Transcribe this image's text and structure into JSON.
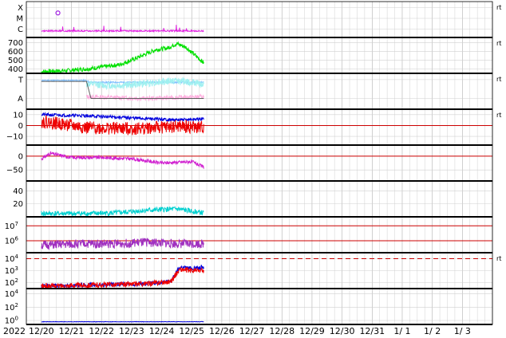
{
  "chart_data": {
    "type": "line",
    "year_label": "2022",
    "x_ticks": [
      "12/20",
      "12/21",
      "12/22",
      "12/23",
      "12/24",
      "12/25",
      "12/26",
      "12/27",
      "12/28",
      "12/29",
      "12/30",
      "12/31",
      "1/ 1",
      "1/ 2",
      "1/ 3"
    ],
    "data_end_index": 5.4,
    "panels": [
      {
        "id": "xray-class",
        "y_range": [
          0,
          3
        ],
        "y_tick_labels": [
          {
            "v": 2.5,
            "t": "X"
          },
          {
            "v": 1.6,
            "t": "M"
          },
          {
            "v": 0.7,
            "t": "C"
          }
        ],
        "ref_lines": [],
        "side_label": "rt",
        "series": [
          {
            "color": "#e020e0",
            "base": 0.55,
            "amp": 0.12,
            "spike": 0.5,
            "seed": 3
          }
        ],
        "marker": {
          "x": 0.55,
          "y": 2.05,
          "color": "#a020e0"
        }
      },
      {
        "id": "solar-wind-speed",
        "y_range": [
          350,
          760
        ],
        "y_tick_labels": [
          {
            "v": 700,
            "t": "700"
          },
          {
            "v": 600,
            "t": "600"
          },
          {
            "v": 500,
            "t": "500"
          },
          {
            "v": 400,
            "t": "400"
          }
        ],
        "ref_lines": [],
        "side_label": "rt",
        "series": [
          {
            "color": "#00e000",
            "profile": [
              [
                0,
                370
              ],
              [
                0.8,
                380
              ],
              [
                1.5,
                400
              ],
              [
                2.2,
                430
              ],
              [
                2.6,
                450
              ],
              [
                3.0,
                500
              ],
              [
                3.4,
                560
              ],
              [
                3.8,
                620
              ],
              [
                4.2,
                640
              ],
              [
                4.5,
                690
              ],
              [
                4.8,
                650
              ],
              [
                5.1,
                560
              ],
              [
                5.4,
                470
              ]
            ],
            "noise": 25,
            "seed": 7
          }
        ]
      },
      {
        "id": "temperature-alpha",
        "y_range": [
          0,
          4
        ],
        "y_tick_labels": [
          {
            "v": 3.3,
            "t": "T"
          },
          {
            "v": 1.2,
            "t": "A"
          }
        ],
        "ref_lines": [],
        "side_label": "rt",
        "series": [
          {
            "color": "#80c0ff",
            "profile": [
              [
                0,
                3.2
              ],
              [
                1.5,
                3.2
              ],
              [
                1.6,
                3.0
              ],
              [
                5.4,
                3.0
              ]
            ],
            "noise": 0.08,
            "seed": 11
          },
          {
            "color": "#a0f0f0",
            "profile": [
              [
                1.5,
                2.8
              ],
              [
                2.5,
                2.6
              ],
              [
                3.5,
                2.9
              ],
              [
                4.5,
                3.2
              ],
              [
                5.4,
                2.8
              ]
            ],
            "noise": 0.4,
            "seed": 12
          },
          {
            "color": "#ffb0e0",
            "profile": [
              [
                1.5,
                1.4
              ],
              [
                2.5,
                1.3
              ],
              [
                3.5,
                1.2
              ],
              [
                4.5,
                1.3
              ],
              [
                5.4,
                1.4
              ]
            ],
            "noise": 0.25,
            "seed": 13
          },
          {
            "color": "#606060",
            "profile": [
              [
                0,
                3.1
              ],
              [
                1.5,
                3.1
              ],
              [
                1.65,
                1.2
              ],
              [
                5.4,
                1.2
              ]
            ],
            "noise": 0.0,
            "seed": 14
          }
        ]
      },
      {
        "id": "imf-bt-bz",
        "y_range": [
          -18,
          15
        ],
        "y_tick_labels": [
          {
            "v": 10,
            "t": "10"
          },
          {
            "v": 0,
            "t": "0"
          },
          {
            "v": -10,
            "t": "−10"
          }
        ],
        "ref_lines": [
          {
            "v": 0,
            "color": "#cc0000"
          }
        ],
        "side_label": "rt",
        "series": [
          {
            "color": "#0000dd",
            "profile": [
              [
                0,
                10
              ],
              [
                1.5,
                9
              ],
              [
                3.0,
                7
              ],
              [
                4.5,
                5
              ],
              [
                5.4,
                6
              ]
            ],
            "noise": 1.5,
            "seed": 21
          },
          {
            "color": "#ee0000",
            "profile": [
              [
                0,
                4
              ],
              [
                1.5,
                -2
              ],
              [
                3.0,
                -3
              ],
              [
                4.5,
                -1
              ],
              [
                5.4,
                -2
              ]
            ],
            "noise": 6,
            "seed": 22
          }
        ]
      },
      {
        "id": "phi-angle",
        "y_range": [
          -90,
          40
        ],
        "y_tick_labels": [
          {
            "v": 0,
            "t": "0"
          },
          {
            "v": -50,
            "t": "−50"
          }
        ],
        "ref_lines": [
          {
            "v": 0,
            "color": "#cc0000"
          }
        ],
        "side_label": "",
        "series": [
          {
            "color": "#d020d0",
            "profile": [
              [
                0,
                -10
              ],
              [
                0.3,
                10
              ],
              [
                1.0,
                -5
              ],
              [
                2.0,
                -5
              ],
              [
                3.0,
                -10
              ],
              [
                4.0,
                -25
              ],
              [
                5.0,
                -20
              ],
              [
                5.4,
                -40
              ]
            ],
            "noise": 6,
            "seed": 31
          }
        ]
      },
      {
        "id": "density",
        "y_range": [
          0,
          55
        ],
        "y_tick_labels": [
          {
            "v": 40,
            "t": "40"
          },
          {
            "v": 20,
            "t": "20"
          }
        ],
        "ref_lines": [],
        "side_label": "",
        "series": [
          {
            "color": "#00d0d0",
            "profile": [
              [
                0,
                5
              ],
              [
                1.5,
                5
              ],
              [
                2.5,
                6
              ],
              [
                3.5,
                10
              ],
              [
                4.5,
                12
              ],
              [
                5.4,
                6
              ]
            ],
            "noise": 4,
            "seed": 41
          }
        ]
      },
      {
        "id": "electron-flux",
        "y_range": [
          5.2,
          7.6
        ],
        "log": true,
        "y_tick_labels": [
          {
            "v": 7,
            "t": "10",
            "e": "7"
          },
          {
            "v": 6,
            "t": "10",
            "e": "6"
          }
        ],
        "ref_lines": [
          {
            "v": 7,
            "color": "#cc0000"
          },
          {
            "v": 6,
            "color": "#cc0000"
          }
        ],
        "side_label": "",
        "series": [
          {
            "color": "#a030c0",
            "profile": [
              [
                0,
                5.7
              ],
              [
                1.5,
                5.8
              ],
              [
                2.5,
                5.8
              ],
              [
                3.5,
                5.9
              ],
              [
                4.5,
                5.8
              ],
              [
                5.4,
                5.8
              ]
            ],
            "noise": 0.3,
            "seed": 51
          }
        ]
      },
      {
        "id": "proton-flux",
        "y_range": [
          1.5,
          4.5
        ],
        "log": true,
        "y_tick_labels": [
          {
            "v": 4,
            "t": "10",
            "e": "4"
          },
          {
            "v": 3,
            "t": "10",
            "e": "3"
          },
          {
            "v": 2,
            "t": "10",
            "e": "2"
          }
        ],
        "ref_lines": [
          {
            "v": 4,
            "color": "#cc0000",
            "dash": true
          }
        ],
        "side_label": "rt",
        "series": [
          {
            "color": "#0000dd",
            "profile": [
              [
                0,
                1.7
              ],
              [
                3.5,
                1.9
              ],
              [
                4.3,
                2.1
              ],
              [
                4.6,
                3.3
              ],
              [
                5.0,
                3.2
              ],
              [
                5.4,
                3.3
              ]
            ],
            "noise": 0.18,
            "seed": 61
          },
          {
            "color": "#ee0000",
            "profile": [
              [
                0,
                1.7
              ],
              [
                3.5,
                1.9
              ],
              [
                4.3,
                2.1
              ],
              [
                4.6,
                3.1
              ],
              [
                5.0,
                3.0
              ],
              [
                5.4,
                3.0
              ]
            ],
            "noise": 0.22,
            "seed": 62
          }
        ]
      },
      {
        "id": "high-energy-flux",
        "y_range": [
          -0.6,
          4.8
        ],
        "log": true,
        "y_tick_labels": [
          {
            "v": 4,
            "t": "10",
            "e": "4"
          },
          {
            "v": 2,
            "t": "10",
            "e": "2"
          },
          {
            "v": 0,
            "t": "10",
            "e": "0"
          }
        ],
        "ref_lines": [],
        "side_label": "",
        "series": [
          {
            "color": "#0000dd",
            "profile": [
              [
                0,
                -0.2
              ],
              [
                5.4,
                -0.2
              ]
            ],
            "noise": 0.03,
            "seed": 71
          }
        ]
      }
    ]
  }
}
